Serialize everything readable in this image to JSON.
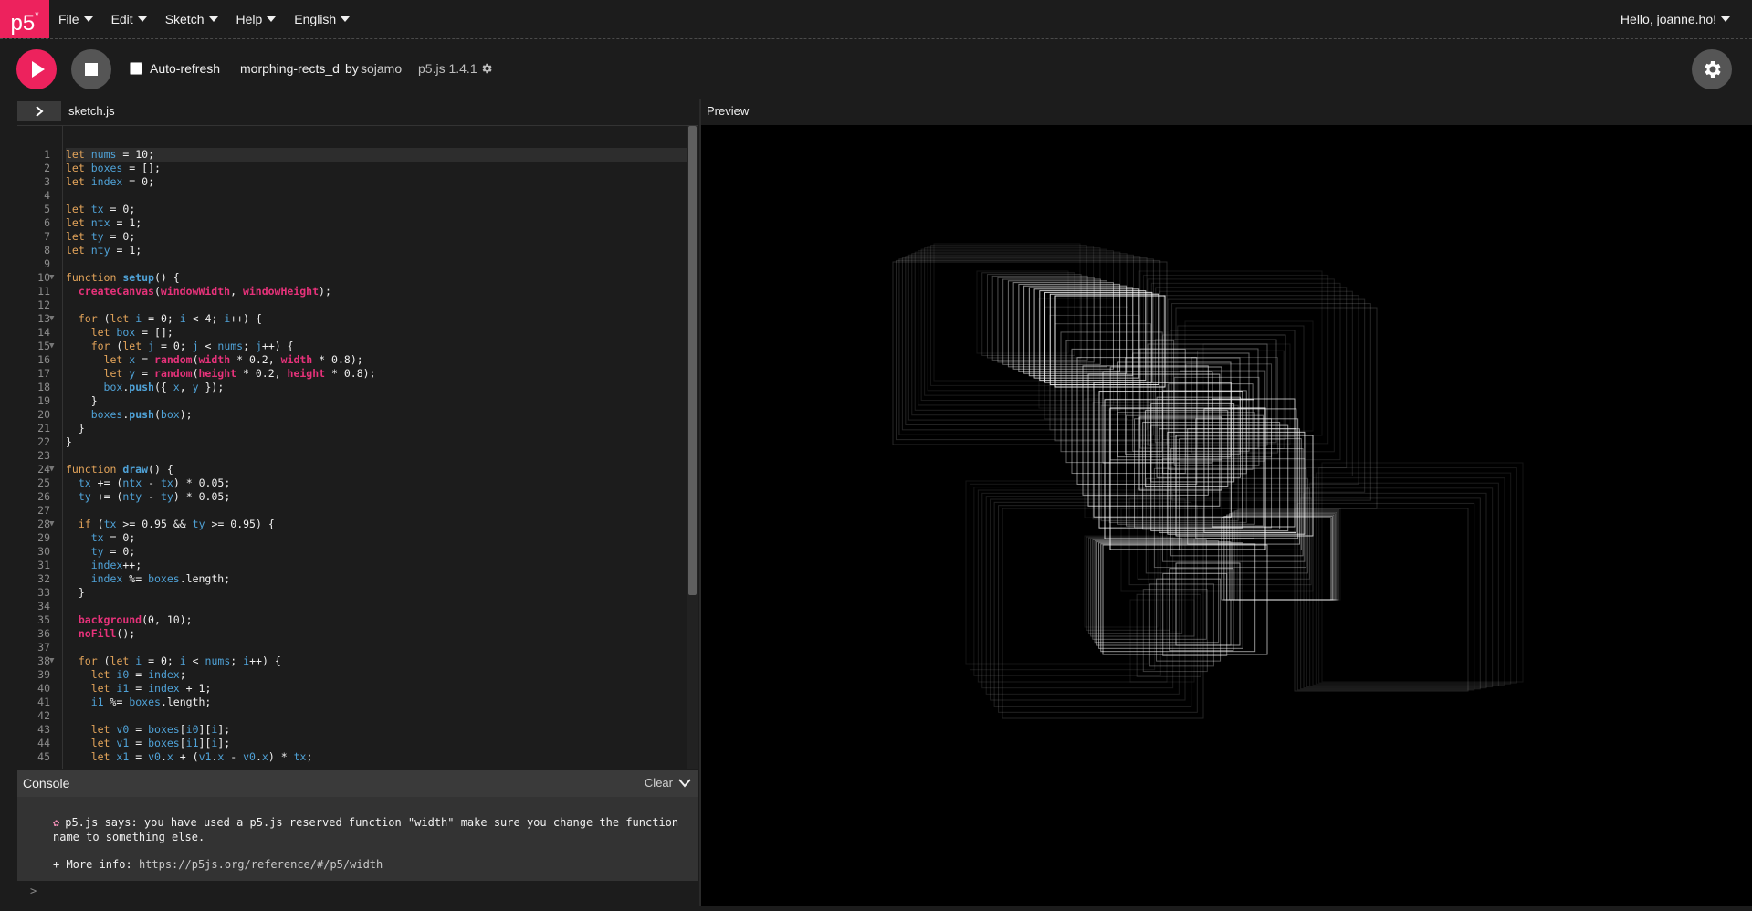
{
  "nav": {
    "logo": "p5",
    "logo_mark": "*",
    "menu": [
      {
        "label": "File"
      },
      {
        "label": "Edit"
      },
      {
        "label": "Sketch"
      },
      {
        "label": "Help"
      },
      {
        "label": "English"
      }
    ],
    "greeting": "Hello, joanne.ho!"
  },
  "toolbar": {
    "auto_refresh_label": "Auto-refresh",
    "auto_refresh_checked": false,
    "sketch_name": "morphing-rects_d",
    "by_label": "by",
    "author": "sojamo",
    "version": "p5.js 1.4.1"
  },
  "editor": {
    "filename": "sketch.js",
    "active_line": 1,
    "lines": [
      "let nums = 10;",
      "let boxes = [];",
      "let index = 0;",
      "",
      "let tx = 0;",
      "let ntx = 1;",
      "let ty = 0;",
      "let nty = 1;",
      "",
      "function setup() {",
      "  createCanvas(windowWidth, windowHeight);",
      "",
      "  for (let i = 0; i < 4; i++) {",
      "    let box = [];",
      "    for (let j = 0; j < nums; j++) {",
      "      let x = random(width * 0.2, width * 0.8);",
      "      let y = random(height * 0.2, height * 0.8);",
      "      box.push({ x, y });",
      "    }",
      "    boxes.push(box);",
      "  }",
      "}",
      "",
      "function draw() {",
      "  tx += (ntx - tx) * 0.05;",
      "  ty += (nty - ty) * 0.05;",
      "",
      "  if (tx >= 0.95 && ty >= 0.95) {",
      "    tx = 0;",
      "    ty = 0;",
      "    index++;",
      "    index %= boxes.length;",
      "  }",
      "",
      "  background(0, 10);",
      "  noFill();",
      "",
      "  for (let i = 0; i < nums; i++) {",
      "    let i0 = index;",
      "    let i1 = index + 1;",
      "    i1 %= boxes.length;",
      "",
      "    let v0 = boxes[i0][i];",
      "    let v1 = boxes[i1][i];",
      "    let x1 = v0.x + (v1.x - v0.x) * tx;"
    ],
    "fold_lines": [
      10,
      13,
      15,
      24,
      28,
      38
    ]
  },
  "preview": {
    "label": "Preview"
  },
  "console": {
    "title": "Console",
    "clear_label": "Clear",
    "message": "p5.js says: you have used a p5.js reserved function \"width\" make sure you change the function name to something else.",
    "more_info_label": "+ More info:",
    "more_info_url": "https://p5js.org/reference/#/p5/width",
    "prompt": ">"
  },
  "colors": {
    "brand": "#ed225d",
    "background": "#1c1c1c",
    "keyword": "#e3a45a",
    "variable": "#4fa2d7",
    "builtin": "#e6327a"
  }
}
